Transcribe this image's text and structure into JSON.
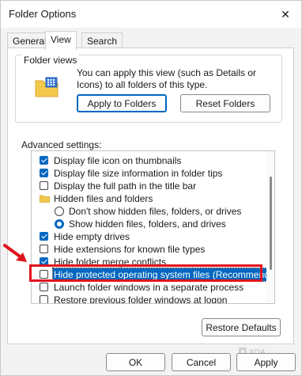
{
  "window": {
    "title": "Folder Options",
    "close_glyph": "✕"
  },
  "tabs": [
    {
      "label": "General"
    },
    {
      "label": "View"
    },
    {
      "label": "Search"
    }
  ],
  "folder_views": {
    "group_title": "Folder views",
    "description": "You can apply this view (such as Details or Icons) to all folders of this type.",
    "apply_button": "Apply to Folders",
    "reset_button": "Reset Folders"
  },
  "advanced": {
    "label": "Advanced settings:",
    "items": [
      {
        "label": "Display file icon on thumbnails",
        "control": "checkbox",
        "checked": true
      },
      {
        "label": "Display file size information in folder tips",
        "control": "checkbox",
        "checked": true
      },
      {
        "label": "Display the full path in the title bar",
        "control": "checkbox",
        "checked": false
      },
      {
        "label": "Hidden files and folders",
        "control": "folder"
      },
      {
        "label": "Don't show hidden files, folders, or drives",
        "control": "radio",
        "checked": false
      },
      {
        "label": "Show hidden files, folders, and drives",
        "control": "radio",
        "checked": true
      },
      {
        "label": "Hide empty drives",
        "control": "checkbox",
        "checked": true
      },
      {
        "label": "Hide extensions for known file types",
        "control": "checkbox",
        "checked": false
      },
      {
        "label": "Hide folder merge conflicts",
        "control": "checkbox",
        "checked": true
      },
      {
        "label": "Hide protected operating system files (Recommended)",
        "control": "checkbox",
        "checked": false
      },
      {
        "label": "Launch folder windows in a separate process",
        "control": "checkbox",
        "checked": false
      },
      {
        "label": "Restore previous folder windows at logon",
        "control": "checkbox",
        "checked": false
      }
    ],
    "restore_button": "Restore Defaults"
  },
  "footer": {
    "ok": "OK",
    "cancel": "Cancel",
    "apply": "Apply"
  },
  "watermark": "XDA",
  "colors": {
    "accent": "#0067c0",
    "highlight_box": "#e0141e",
    "arrow": "#e0141e"
  }
}
